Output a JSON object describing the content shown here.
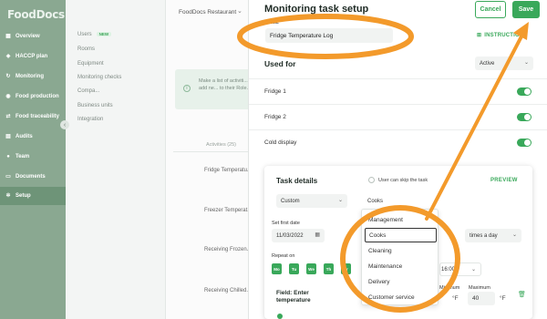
{
  "app": {
    "logo": "FoodDocs"
  },
  "sidebar": {
    "items": [
      {
        "label": "Overview",
        "icon": "grid-icon"
      },
      {
        "label": "HACCP plan",
        "icon": "shield-icon"
      },
      {
        "label": "Monitoring",
        "icon": "refresh-icon"
      },
      {
        "label": "Food production",
        "icon": "pot-icon"
      },
      {
        "label": "Food traceability",
        "icon": "route-icon"
      },
      {
        "label": "Audits",
        "icon": "clipboard-icon"
      },
      {
        "label": "Team",
        "icon": "person-icon"
      },
      {
        "label": "Documents",
        "icon": "folder-icon"
      },
      {
        "label": "Setup",
        "icon": "gear-icon",
        "active": true
      }
    ]
  },
  "submenu": {
    "items": [
      {
        "label": "Users",
        "badge": "NEW"
      },
      {
        "label": "Rooms"
      },
      {
        "label": "Equipment"
      },
      {
        "label": "Monitoring checks"
      },
      {
        "label": "Compa..."
      },
      {
        "label": "Business units"
      },
      {
        "label": "Integration"
      }
    ]
  },
  "main": {
    "restaurant": "FoodDocs Restaurant",
    "info_text": "Make a list of activiti... templates or add ne... to their Role.",
    "activities_tab": "Activities (25)",
    "rows": [
      "Fridge Temperatu...",
      "Freezer Temperat...",
      "Receiving Frozen...",
      "Receiving Chilled..."
    ]
  },
  "panel": {
    "title": "Monitoring task setup",
    "cancel_label": "Cancel",
    "save_label": "Save",
    "name_label": "Name",
    "name_value": "Fridge Temperature Log",
    "instructions_label": "INSTRUCTIONS",
    "used_for_heading": "Used for",
    "active_select": "Active",
    "units": [
      {
        "name": "Fridge 1",
        "enabled": true
      },
      {
        "name": "Fridge 2",
        "enabled": true
      },
      {
        "name": "Cold display",
        "enabled": true
      }
    ]
  },
  "task_details": {
    "title": "Task details",
    "skip_label": "User can skip the task",
    "preview_label": "PREVIEW",
    "schedule_select": "Custom",
    "role_select": "Cooks",
    "first_date_label": "Set first date",
    "first_date_value": "11/03/2022",
    "frequency_select": "times a day",
    "repeat_label": "Repeat on",
    "days": [
      "Mo",
      "Tu",
      "We",
      "Th",
      "Fr"
    ],
    "time_value": "16:00",
    "field_label": "Field: Enter temperature",
    "min_label": "Minimum",
    "max_label": "Maximum",
    "max_value": "40",
    "unit": "°F",
    "row_stub_r": "Ti",
    "row_stub_n": "n"
  },
  "dropdown": {
    "options": [
      "Management",
      "Cooks",
      "Cleaning",
      "Maintenance",
      "Delivery",
      "Customer service"
    ],
    "selected": "Cooks"
  },
  "colors": {
    "accent": "#39a85a",
    "annotation": "#f39a2b",
    "sidebar": "#8aa891"
  }
}
